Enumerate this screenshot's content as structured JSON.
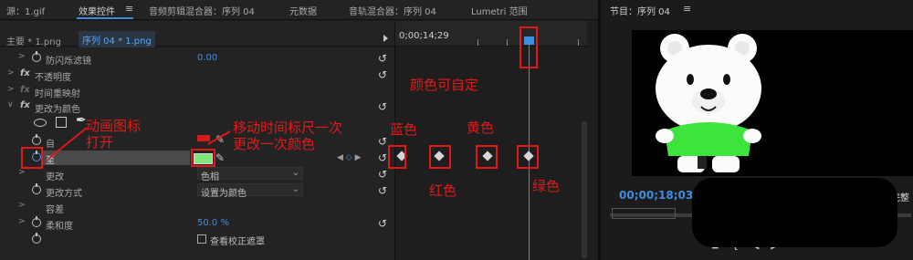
{
  "tabs": {
    "source": "源：1.gif",
    "effect_controls": "效果控件",
    "audio_clip_mixer": "音频剪辑混合器：序列 04",
    "metadata": "元数据",
    "audio_track_mixer": "音轨混合器：序列 04",
    "lumetri": "Lumetri 范围",
    "program": "节目：序列 04"
  },
  "clip_header": {
    "master_clip": "主要 * 1.png",
    "sequence_clip": "序列 04 * 1.png"
  },
  "timeline": {
    "timecode": "0;00;14;29"
  },
  "effects": {
    "anti_flicker": {
      "label": "防闪烁滤镜",
      "value": "0.00"
    },
    "opacity": "不透明度",
    "time_remap": "时间重映射",
    "change_to_color": "更改为颜色",
    "from": "自",
    "to": "至",
    "change": {
      "label": "更改",
      "value": "色相"
    },
    "change_by": {
      "label": "更改方式",
      "value": "设置为颜色"
    },
    "tolerance": "容差",
    "softness": {
      "label": "柔和度",
      "value": "50.0 %"
    },
    "view_mask": "查看校正遮罩"
  },
  "annotations": {
    "anim_icon": "动画图标",
    "open": "打开",
    "move_playhead": "移动时间标尺一次",
    "change_color": "更改一次颜色",
    "custom_color": "颜色可自定",
    "blue": "蓝色",
    "yellow": "黄色",
    "red": "红色",
    "green": "绿色"
  },
  "program_monitor": {
    "timecode": "00;00;18;03",
    "fit": "完整"
  },
  "colors": {
    "accent_blue": "#3d8de0",
    "annotation_red": "#e01818",
    "from_swatch": "#d41a1a",
    "to_swatch": "#7ee67a",
    "bear_shirt": "#3ee43c"
  },
  "icons": {
    "reset": "reset-icon",
    "stopwatch": "stopwatch-icon",
    "pen": "pen-mask-icon",
    "eyedropper": "eyedropper-icon",
    "keyframe": "keyframe-diamond-icon"
  }
}
